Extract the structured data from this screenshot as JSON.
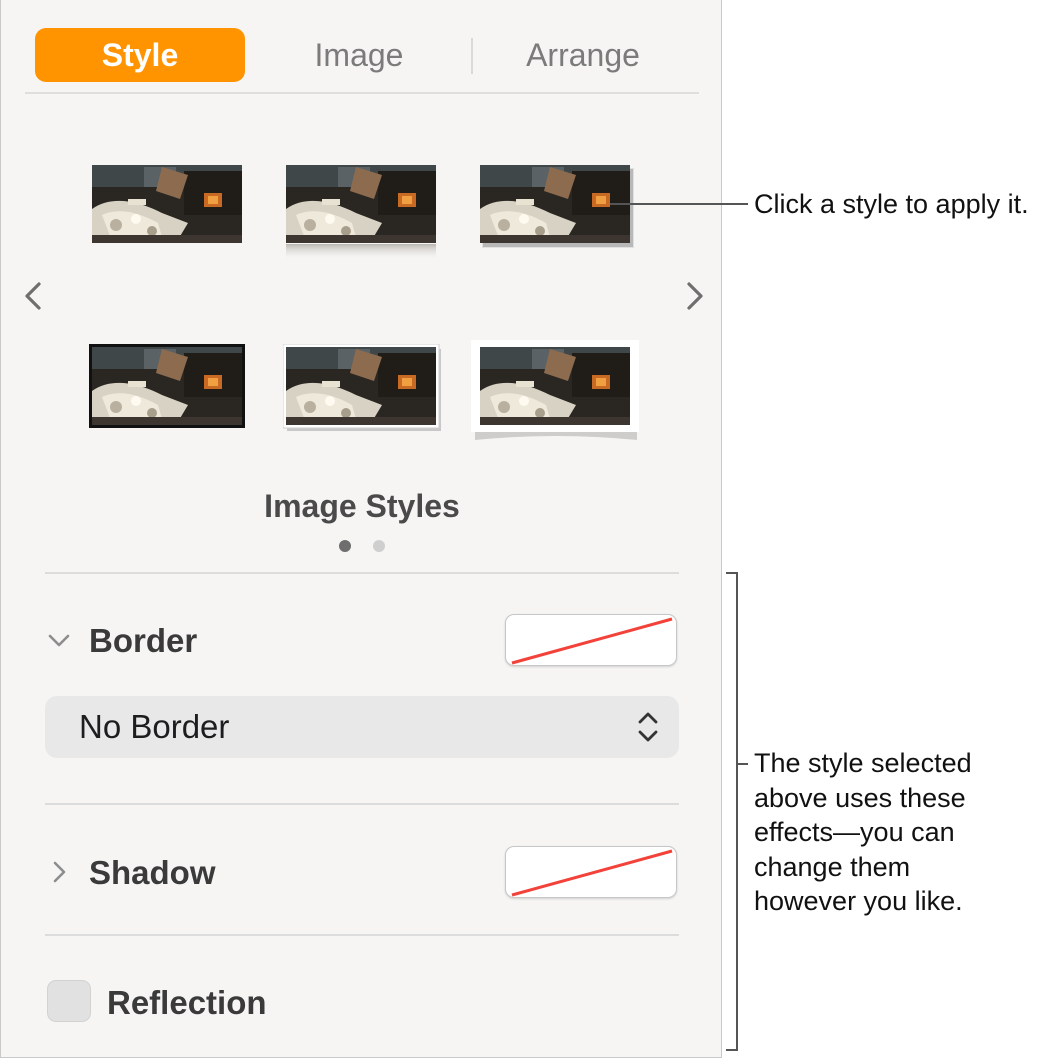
{
  "tabs": [
    {
      "label": "Style",
      "active": true
    },
    {
      "label": "Image",
      "active": false
    },
    {
      "label": "Arrange",
      "active": false
    }
  ],
  "accent_color": "#ff9300",
  "image_styles": {
    "title": "Image Styles",
    "page_count": 2,
    "current_page": 1,
    "items": [
      {
        "name": "no-border"
      },
      {
        "name": "reflection"
      },
      {
        "name": "drop-shadow"
      },
      {
        "name": "thin-border"
      },
      {
        "name": "frame-shadow"
      },
      {
        "name": "photo-curl"
      }
    ]
  },
  "border": {
    "label": "Border",
    "expanded": true,
    "selected": "No Border",
    "color_swatch": "none"
  },
  "shadow": {
    "label": "Shadow",
    "expanded": false,
    "color_swatch": "none"
  },
  "reflection": {
    "label": "Reflection",
    "checked": false
  },
  "annotations": {
    "styles_callout": "Click a style to apply it.",
    "effects_callout": [
      "The style selected",
      "above uses these",
      "effects—you can",
      "change them",
      "however you like."
    ]
  }
}
